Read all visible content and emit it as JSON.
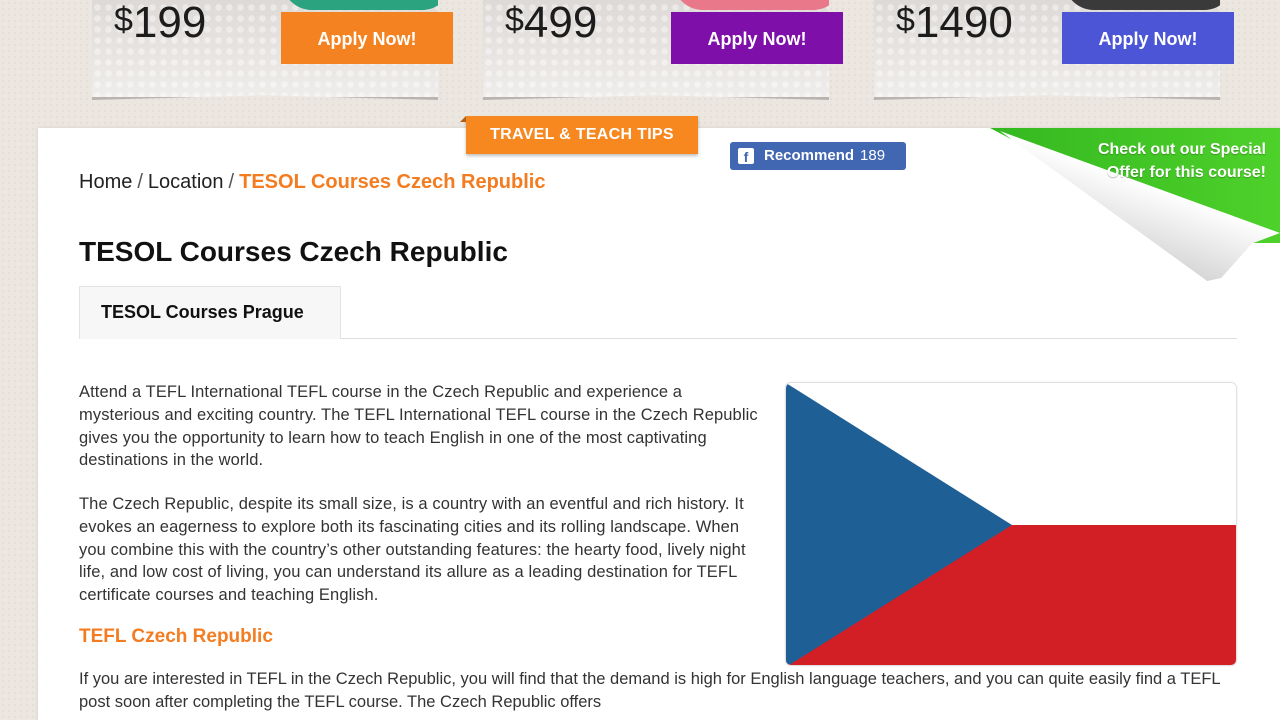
{
  "pricing": [
    {
      "currency": "$",
      "amount": "199",
      "cta": "Apply Now!",
      "color": "#f58220"
    },
    {
      "currency": "$",
      "amount": "499",
      "cta": "Apply Now!",
      "color": "#7e0fa8"
    },
    {
      "currency": "$",
      "amount": "1490",
      "cta": "Apply Now!",
      "color": "#4b55d6"
    }
  ],
  "tips_tab": "TRAVEL & TEACH TIPS",
  "facebook": {
    "label": "Recommend",
    "count": "189",
    "icon": "f"
  },
  "special_offer": "Check out our Special Offer for this course!",
  "breadcrumb": {
    "home": "Home",
    "location": "Location",
    "separator": "/",
    "current": "TESOL Courses Czech Republic"
  },
  "page_title": "TESOL Courses Czech Republic",
  "tabs": [
    {
      "label": "TESOL Courses Prague"
    }
  ],
  "content": {
    "para1": "Attend a TEFL International TEFL course in the Czech Republic and experience a mysterious and exciting country. The TEFL International TEFL course in the Czech Republic gives you the opportunity to learn how to teach English in one of the most captivating destinations in the world.",
    "para2": "The Czech Republic, despite its small size, is a country with an eventful and rich history. It evokes an eagerness to explore both its fascinating cities and its rolling landscape. When you combine this with the country’s other outstanding features: the hearty food, lively night life, and low cost of living, you can understand its allure as a leading destination for TEFL certificate courses and teaching English.",
    "subheading": "TEFL Czech Republic",
    "para3": "If you are interested in TEFL in the Czech Republic, you will find that the demand is high for English language teachers, and you can quite easily find a TEFL post soon after completing the TEFL course. The Czech Republic offers"
  },
  "flag_colors": {
    "blue": "#1e5f96",
    "red": "#d21f26",
    "white": "#ffffff"
  },
  "accent_color": "#f47c20"
}
